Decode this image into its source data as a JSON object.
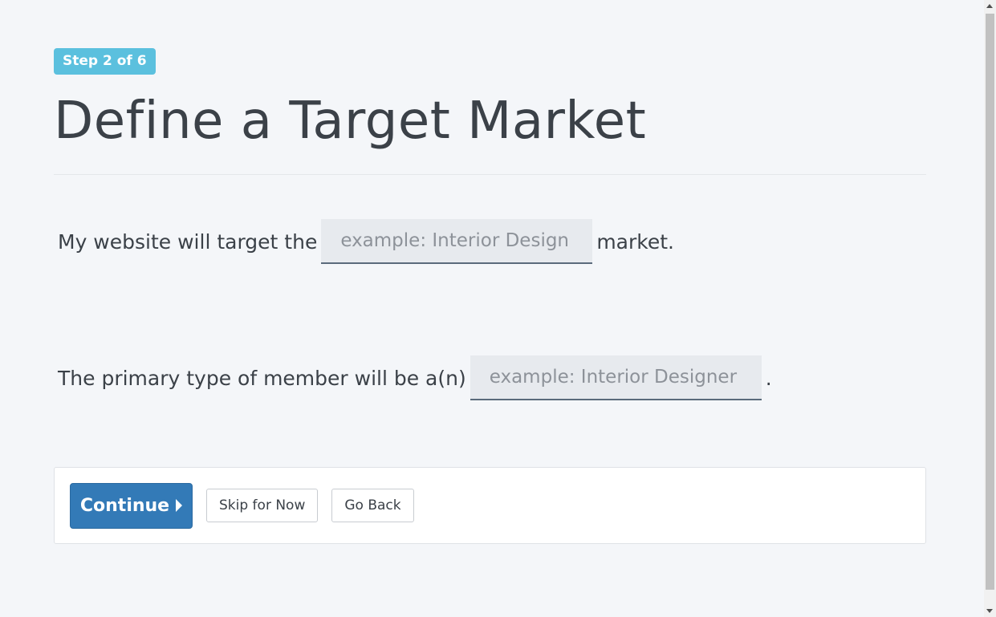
{
  "badge": {
    "step_label": "Step 2 of 6"
  },
  "header": {
    "title": "Define a Target Market"
  },
  "form": {
    "market_sentence": {
      "prefix": "My website will target the",
      "input_value": "",
      "input_placeholder": "example: Interior Design",
      "suffix": "market."
    },
    "member_sentence": {
      "prefix": "The primary type of member will be a(n)",
      "input_value": "",
      "input_placeholder": "example: Interior Designer",
      "suffix": "."
    }
  },
  "actions": {
    "continue_label": "Continue",
    "continue_icon": "caret-right-icon",
    "skip_label": "Skip for Now",
    "back_label": "Go Back"
  },
  "colors": {
    "badge": "#5bc0de",
    "primary": "#337ab7",
    "background": "#f4f6f9",
    "text": "#3b4148"
  }
}
